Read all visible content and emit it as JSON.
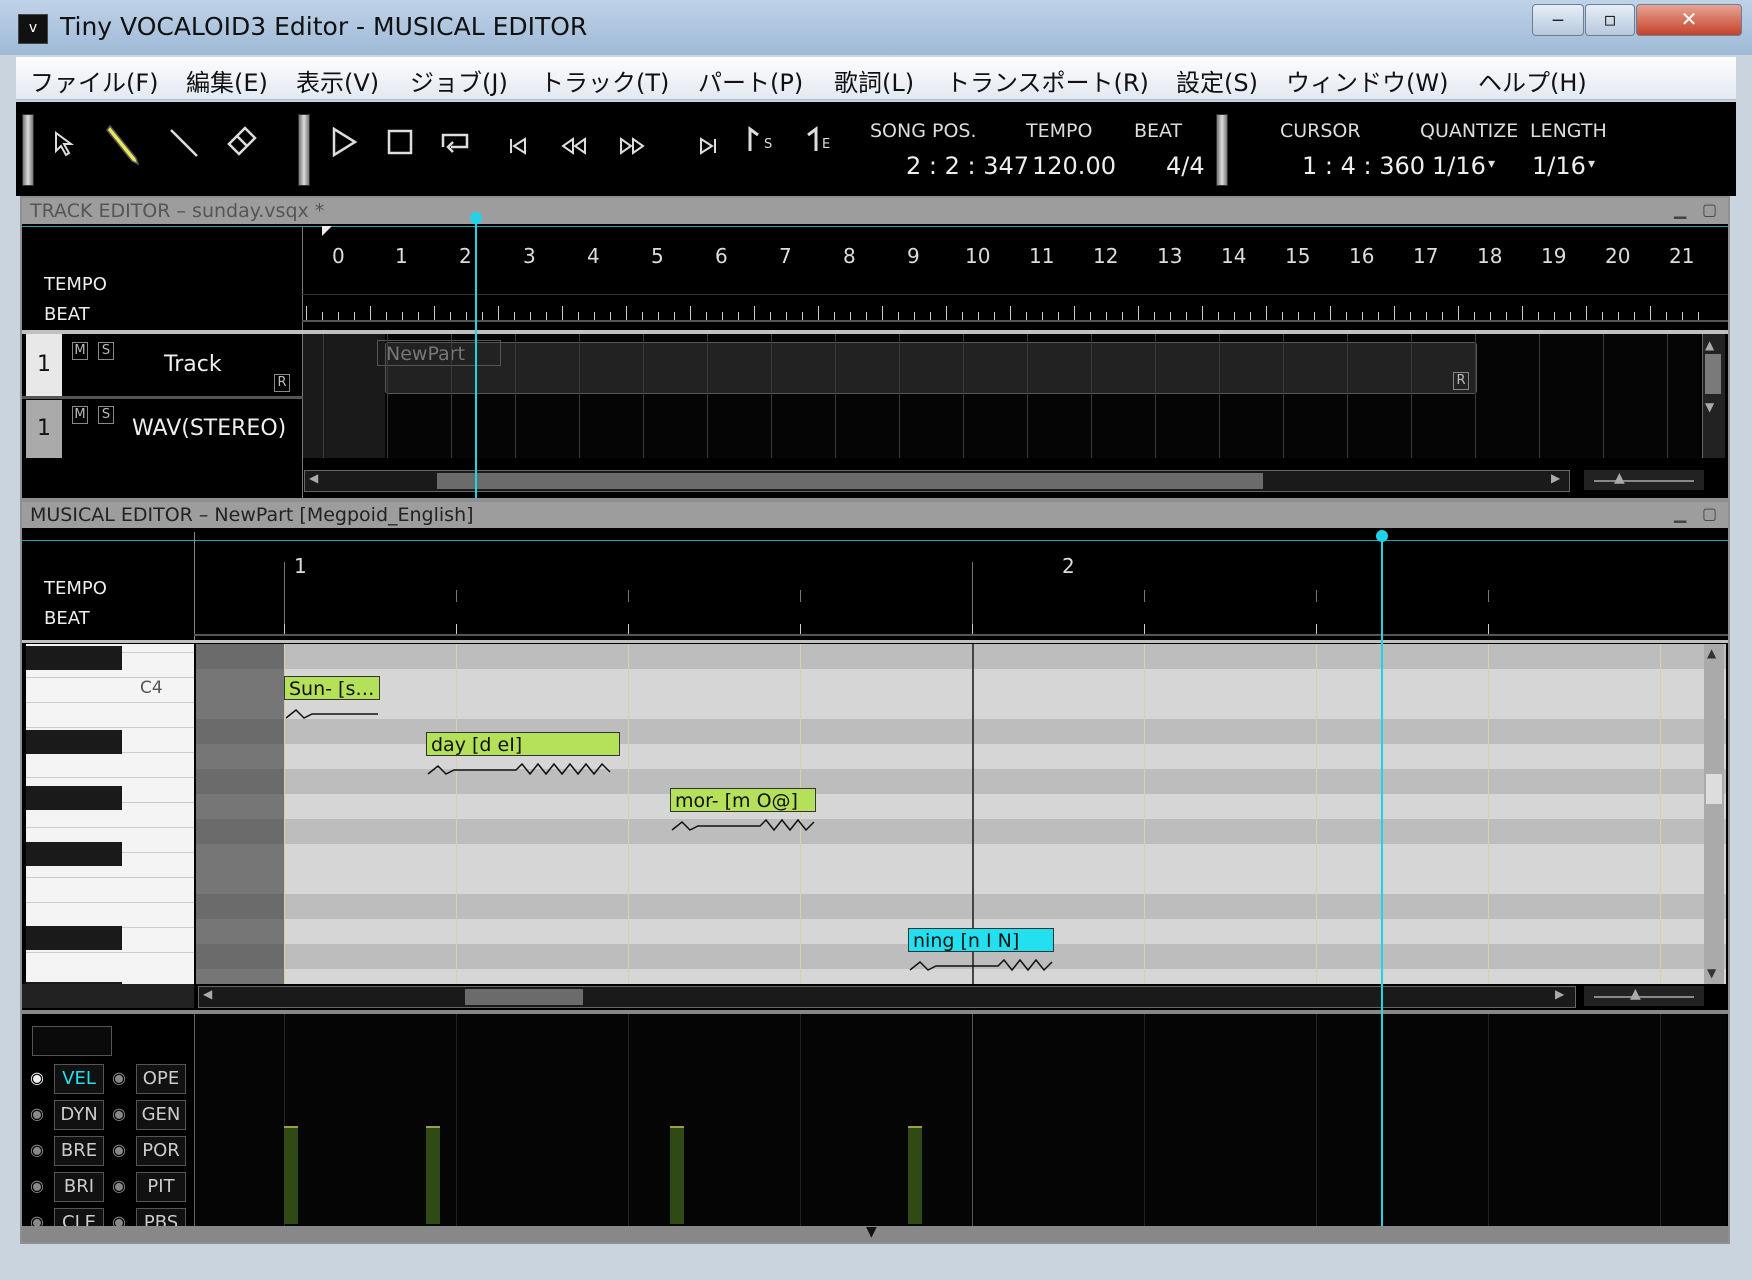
{
  "window": {
    "title": "Tiny VOCALOID3 Editor - MUSICAL EDITOR",
    "app_icon": "v",
    "controls": {
      "minimize": "‒",
      "maximize": "▫",
      "close": "✕"
    }
  },
  "menu": [
    "ファイル(F)",
    "編集(E)",
    "表示(V)",
    "ジョブ(J)",
    "トラック(T)",
    "パート(P)",
    "歌詞(L)",
    "トランスポート(R)",
    "設定(S)",
    "ウィンドウ(W)",
    "ヘルプ(H)"
  ],
  "toolbar": {
    "tools": [
      "arrow-icon",
      "pencil-icon",
      "line-icon",
      "eraser-icon"
    ],
    "transport": [
      "play-icon",
      "stop-icon",
      "loop-icon",
      "go-start-icon",
      "rewind-icon",
      "fast-forward-icon",
      "go-end-icon",
      "start-marker-icon",
      "end-marker-icon"
    ],
    "start_marker_label": "S",
    "end_marker_label": "E",
    "song_pos_label": "SONG POS.",
    "song_pos": "2 : 2 : 347",
    "tempo_label": "TEMPO",
    "tempo": "120.00",
    "beat_label": "BEAT",
    "beat": "4/4",
    "cursor_label": "CURSOR",
    "cursor": "1 : 4 : 360",
    "quantize_label": "QUANTIZE",
    "quantize": "1/16",
    "length_label": "LENGTH",
    "length": "1/16"
  },
  "track_editor": {
    "title": "TRACK EDITOR – sunday.vsqx *",
    "ruler": [
      "0",
      "1",
      "2",
      "3",
      "4",
      "5",
      "6",
      "7",
      "8",
      "9",
      "10",
      "11",
      "12",
      "13",
      "14",
      "15",
      "16",
      "17",
      "18",
      "19",
      "20",
      "21"
    ],
    "tempo_label": "TEMPO",
    "beat_label": "BEAT",
    "tracks": [
      {
        "number": "1",
        "mute": "M",
        "solo": "S",
        "name": "Track",
        "rec": "R"
      },
      {
        "number": "1",
        "mute": "M",
        "solo": "S",
        "name": "WAV(STEREO)"
      }
    ],
    "part": {
      "name": "NewPart",
      "rec": "R"
    }
  },
  "musical_editor": {
    "title": "MUSICAL EDITOR – NewPart [Megpoid_English]",
    "ruler": [
      "1",
      "2"
    ],
    "tempo_label": "TEMPO",
    "beat_label": "BEAT",
    "key_label": "C4",
    "notes": [
      {
        "lyric": "Sun- [s…",
        "color": "#b5e05a"
      },
      {
        "lyric": "day [d eI]",
        "color": "#b5e05a"
      },
      {
        "lyric": "mor- [m O@]",
        "color": "#b5e05a"
      },
      {
        "lyric": "ning [n I N]",
        "color": "#22e0f0"
      }
    ]
  },
  "control_track": {
    "buttons_left": [
      "VEL",
      "DYN",
      "BRE",
      "BRI",
      "CLE"
    ],
    "buttons_right": [
      "OPE",
      "GEN",
      "POR",
      "PIT",
      "PBS"
    ],
    "active": "VEL"
  },
  "colors": {
    "accent_cyan": "#22d3e8",
    "note_green": "#b5e05a",
    "note_selected": "#22e0f0",
    "velocity_bar": "#2f4a12"
  }
}
